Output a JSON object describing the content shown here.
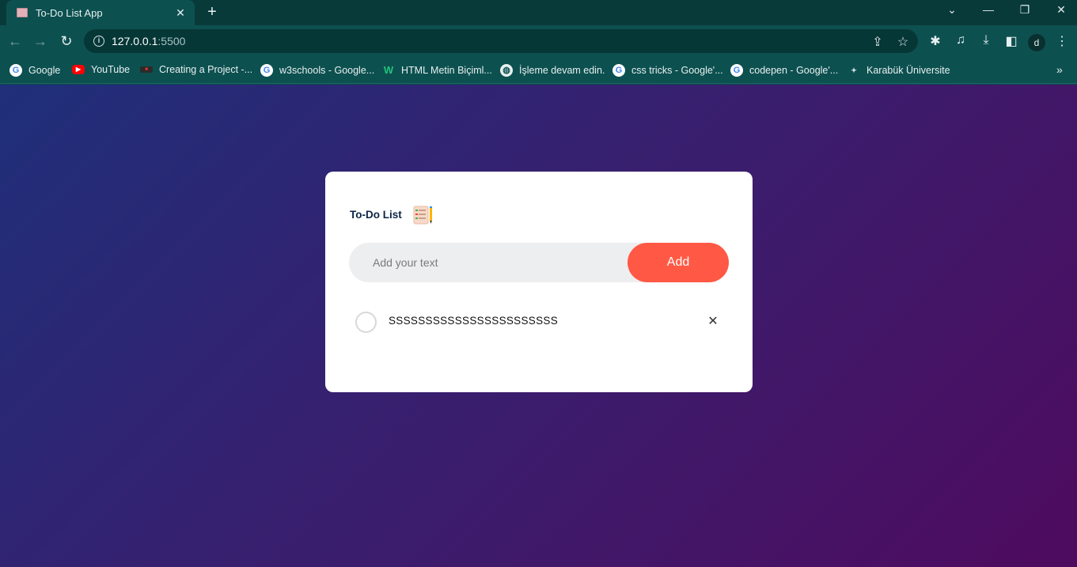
{
  "browser": {
    "tab_title": "To-Do List App",
    "tab_close": "✕",
    "new_tab": "+",
    "url_host": "127.0.0.1",
    "url_port": ":5500",
    "profile_initial": "d",
    "bookmarks": [
      {
        "label": "Google",
        "icon": "google-icon"
      },
      {
        "label": "YouTube",
        "icon": "youtube-icon"
      },
      {
        "label": "Creating a Project -...",
        "icon": "project-icon"
      },
      {
        "label": "w3schools - Google...",
        "icon": "google-icon"
      },
      {
        "label": "HTML Metin Biçiml...",
        "icon": "w-icon"
      },
      {
        "label": "İşleme devam edin.",
        "icon": "globe-icon"
      },
      {
        "label": "css tricks - Google'...",
        "icon": "google-icon"
      },
      {
        "label": "codepen - Google'...",
        "icon": "google-icon"
      },
      {
        "label": "Karabük Üniversite",
        "icon": "karabuk-icon"
      }
    ]
  },
  "app": {
    "title": "To-Do List",
    "input_placeholder": "Add your text",
    "add_label": "Add",
    "tasks": [
      {
        "text": "SSSSSSSSSSSSSSSSSSSSSSS",
        "done": false,
        "delete_label": "✕"
      }
    ]
  },
  "colors": {
    "accent": "#ff5945",
    "title": "#0b2447",
    "gradient_start": "#1f2f7a",
    "gradient_end": "#4e0b5f"
  }
}
